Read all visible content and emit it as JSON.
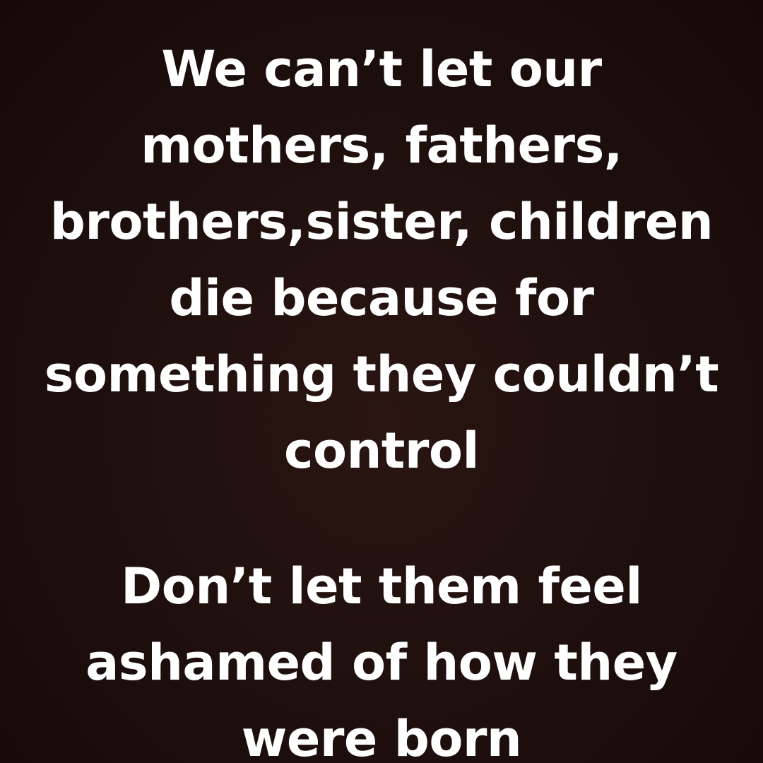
{
  "background_color": "#1f100e",
  "text_color": "#ffffff",
  "message": {
    "paragraph_1": [
      "We can’t let our",
      "mothers, fathers,",
      "brothers,sister, children",
      "die because for",
      "something they couldn’t",
      "control"
    ],
    "paragraph_2": [
      "Don’t let them feel",
      "ashamed of how they",
      "were born"
    ]
  }
}
